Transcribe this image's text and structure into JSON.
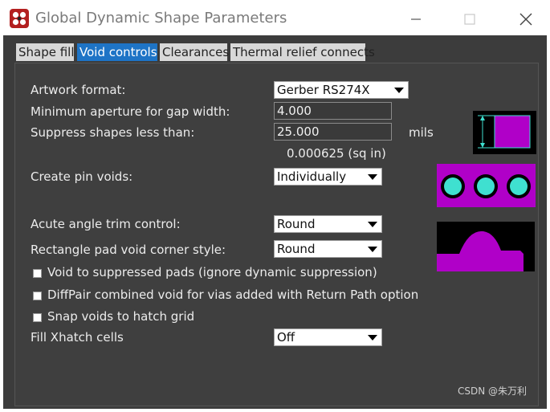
{
  "window": {
    "title": "Global Dynamic Shape Parameters",
    "icons": [
      "app-icon",
      "minimize-icon",
      "maximize-icon",
      "close-icon"
    ]
  },
  "tabs": [
    {
      "label": "Shape fill",
      "active": false
    },
    {
      "label": "Void controls",
      "active": true
    },
    {
      "label": "Clearances",
      "active": false
    },
    {
      "label": "Thermal relief connects",
      "active": false
    }
  ],
  "form": {
    "artwork_format": {
      "label": "Artwork format:",
      "value": "Gerber RS274X"
    },
    "min_aperture": {
      "label": "Minimum aperture for gap width:",
      "value": "4.000"
    },
    "suppress_shapes": {
      "label": "Suppress shapes less than:",
      "value": "25.000",
      "unit": "mils",
      "area": "0.000625 (sq in)"
    },
    "pin_voids": {
      "label": "Create pin voids:",
      "value": "Individually"
    },
    "acute_angle": {
      "label": "Acute angle trim control:",
      "value": "Round"
    },
    "rect_pad_corner": {
      "label": "Rectangle pad void corner style:",
      "value": "Round"
    },
    "void_suppressed_pads": {
      "label": "Void to suppressed pads (ignore dynamic suppression)",
      "checked": false
    },
    "diffpair_void": {
      "label": "DiffPair combined void for vias added with Return Path option",
      "checked": false
    },
    "snap_voids": {
      "label": "Snap voids to hatch grid",
      "checked": false
    },
    "fill_xhatch": {
      "label": "Fill Xhatch cells",
      "value": "Off"
    }
  },
  "colors": {
    "accent": "#1e74c6",
    "shape_magenta": "#b000c8",
    "void_cyan": "#3fe0d0",
    "panel": "#3f3f3f"
  },
  "watermark": "CSDN @朱万利"
}
